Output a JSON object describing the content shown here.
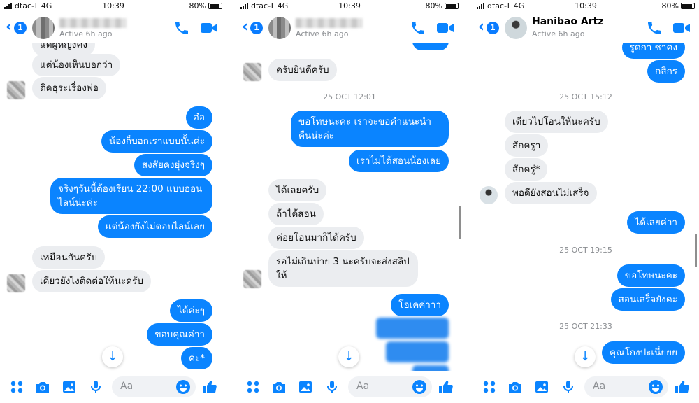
{
  "status_bar": {
    "carrier": "dtac-T",
    "network": "4G",
    "time": "10:39",
    "battery": "80%"
  },
  "colors": {
    "accent": "#0a84ff",
    "incoming_bubble": "#ebedf0",
    "timestamp": "#8a8d91"
  },
  "icons": [
    "back-chevron-icon",
    "phone-icon",
    "video-camera-icon",
    "apps-grid-icon",
    "camera-icon",
    "gallery-icon",
    "microphone-icon",
    "emoji-icon",
    "thumbs-up-icon",
    "arrow-down-icon"
  ],
  "panels": [
    {
      "header": {
        "back_badge": "1",
        "name": "",
        "active": "Active 6h ago"
      },
      "messages": [
        {
          "dir": "in",
          "text": "แต่ผู้หญิงคิง"
        },
        {
          "dir": "in",
          "text": "แต่น้องเห็นบอกว่า"
        },
        {
          "dir": "in",
          "text": "ติดธุระเรื่องพ่อ"
        },
        {
          "dir": "out",
          "text": "อ๋อ"
        },
        {
          "dir": "out",
          "text": "น้องก็บอกเราแบบนั้นค่ะ"
        },
        {
          "dir": "out",
          "text": "สงสัยคงยุ่งจริงๆ"
        },
        {
          "dir": "out",
          "text": "จริงๆวันนี้ต้องเรียน 22:00 แบบออนไลน์น่ะค่ะ"
        },
        {
          "dir": "out",
          "text": "แต่น้องยังไม่ตอบไลน์เลย"
        },
        {
          "dir": "in",
          "text": "เหมือนกันครับ"
        },
        {
          "dir": "in",
          "text": "เดียวยังไงติดต่อให้นะครับ"
        },
        {
          "dir": "out",
          "text": "ได้ค่ะๆ"
        },
        {
          "dir": "out",
          "text": "ขอบคุณค่าา"
        },
        {
          "dir": "out",
          "text": "ค่ะ*"
        }
      ],
      "composer_placeholder": "Aa"
    },
    {
      "header": {
        "back_badge": "1",
        "name": "",
        "active": "Active 6h ago"
      },
      "timestamps": [
        "25 OCT 12:01"
      ],
      "messages": [
        {
          "dir": "in",
          "text": "ครับยินดีครับ"
        },
        {
          "dir": "out",
          "text": "ขอโทษนะคะ เราจะขอคำแนะนำคืนน่ะค่ะ"
        },
        {
          "dir": "out",
          "text": "เราไม่ได้สอนน้องเลย"
        },
        {
          "dir": "in",
          "text": "ได้เลยครับ"
        },
        {
          "dir": "in",
          "text": "ถ้าได้สอน"
        },
        {
          "dir": "in",
          "text": "ค่อยโอนมาก็ได้ครับ"
        },
        {
          "dir": "in",
          "text": "รอไม่เกินบ่าย 3 นะครับจะส่งสลิปให้"
        },
        {
          "dir": "out",
          "text": "โอเคค่าาา"
        }
      ],
      "composer_placeholder": "Aa"
    },
    {
      "header": {
        "back_badge": "1",
        "name": "Hanibao Artz",
        "active": "Active 6h ago"
      },
      "timestamps": [
        "25 OCT 15:12",
        "25 OCT 19:15",
        "25 OCT 21:33"
      ],
      "messages": [
        {
          "dir": "out",
          "text": "รูดกา ชาคง"
        },
        {
          "dir": "out",
          "text": "กสิกร"
        },
        {
          "dir": "in",
          "text": "เดียวไปโอนให้นะครับ"
        },
        {
          "dir": "in",
          "text": "สักครูา"
        },
        {
          "dir": "in",
          "text": "สักครู่*"
        },
        {
          "dir": "in",
          "text": "พอดียังสอนไม่เสร็จ"
        },
        {
          "dir": "out",
          "text": "ได้เลยค่าา"
        },
        {
          "dir": "out",
          "text": "ขอโทษนะคะ"
        },
        {
          "dir": "out",
          "text": "สอนเสร็จยังคะ"
        },
        {
          "dir": "out",
          "text": "คุณโกงปะเนี่ยยย"
        }
      ],
      "composer_placeholder": "Aa"
    }
  ]
}
